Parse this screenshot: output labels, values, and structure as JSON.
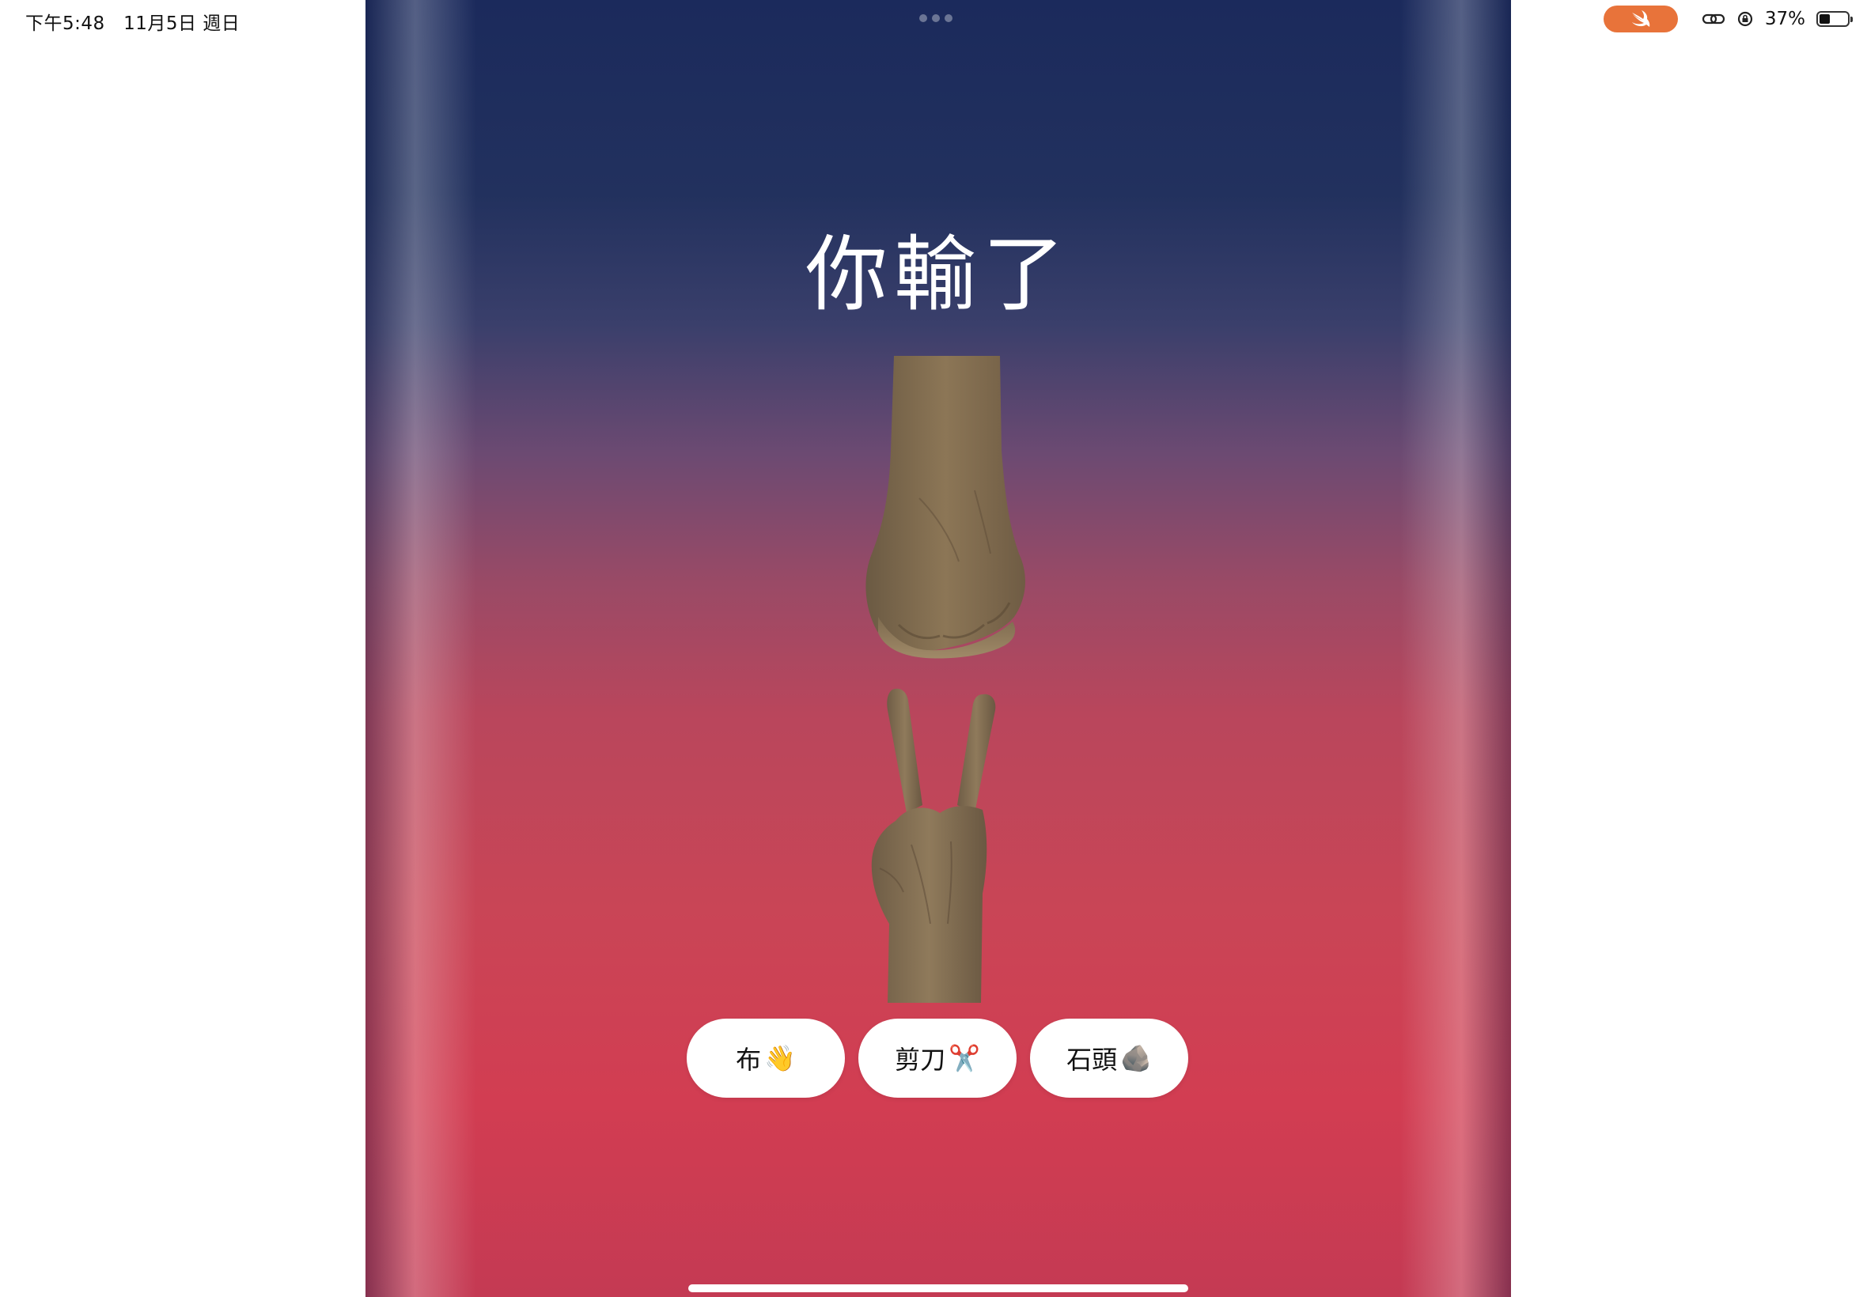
{
  "status_bar": {
    "time": "下午5:48",
    "date": "11月5日 週日",
    "battery_percent": "37%",
    "battery_level": 0.37
  },
  "game": {
    "result": "你輸了",
    "opponent_hand": "rock-fist",
    "player_hand": "scissors-v"
  },
  "choices": [
    {
      "label": "布",
      "emoji": "👋"
    },
    {
      "label": "剪刀",
      "emoji": "✂️"
    },
    {
      "label": "石頭",
      "emoji": "🪨"
    }
  ],
  "colors": {
    "swift_accent": "#e8733a",
    "gradient_top": "#1b2a5c",
    "gradient_bottom": "#d23d52"
  }
}
